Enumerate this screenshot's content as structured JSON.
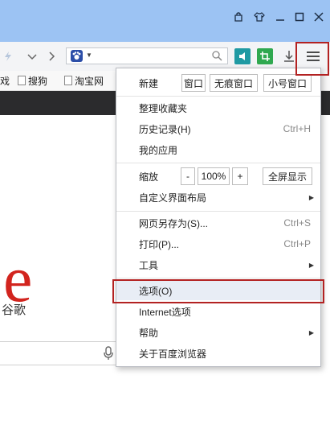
{
  "menu": {
    "new_label": "新建",
    "new_window": "窗口",
    "incognito_window": "无痕窗口",
    "small_window": "小号窗口",
    "organize_favorites": "整理收藏夹",
    "history": "历史记录(H)",
    "history_shortcut": "Ctrl+H",
    "my_apps": "我的应用",
    "zoom_label": "缩放",
    "zoom_minus": "-",
    "zoom_value": "100%",
    "zoom_plus": "+",
    "fullscreen": "全屏显示",
    "custom_layout": "自定义界面布局",
    "save_as": "网页另存为(S)...",
    "save_as_shortcut": "Ctrl+S",
    "print": "打印(P)...",
    "print_shortcut": "Ctrl+P",
    "tools": "工具",
    "options": "选项(O)",
    "internet_options": "Internet选项",
    "help": "帮助",
    "about": "关于百度浏览器"
  },
  "bookmarks": {
    "partial": "戏",
    "item1": "搜狗",
    "item2": "淘宝网"
  },
  "page": {
    "logo_letter": "e",
    "logo_sub": "谷歌"
  },
  "icons": {
    "skin": "skin-icon",
    "shirt": "shirt-icon",
    "minimize": "minimize-icon",
    "maximize": "maximize-icon",
    "close": "close-icon",
    "menu": "hamburger-menu-icon"
  },
  "colors": {
    "titlebar": "#9cc3f3",
    "highlight": "#b32222",
    "logo": "#d2241e",
    "teal": "#1f9aa3",
    "green": "#2fa84f"
  }
}
